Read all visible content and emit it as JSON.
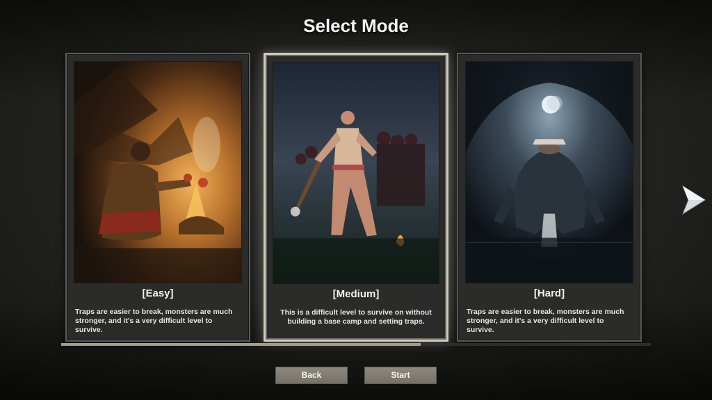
{
  "screen": {
    "title": "Select Mode"
  },
  "modes": [
    {
      "name": "[Easy]",
      "description": "Traps are easier to break, monsters are much stronger, and it's a very difficult level to survive.",
      "art_icon": "campfire-survivor-art"
    },
    {
      "name": "[Medium]",
      "description": "This is a difficult level to survive on without building a base camp and setting traps.",
      "art_icon": "torch-survivor-art"
    },
    {
      "name": "[Hard]",
      "description": "Traps are easier to break, monsters are much stronger, and it's a very difficult level to survive.",
      "art_icon": "cave-monster-art"
    }
  ],
  "selected_mode_index": 1,
  "scroll_progress": 0.61,
  "buttons": {
    "back": "Back",
    "start": "Start"
  },
  "navigation": {
    "next_icon": "chevron-right-icon"
  },
  "colors": {
    "accent": "#cfcbbd",
    "button": "#807c72",
    "progress": "#a39d88"
  }
}
